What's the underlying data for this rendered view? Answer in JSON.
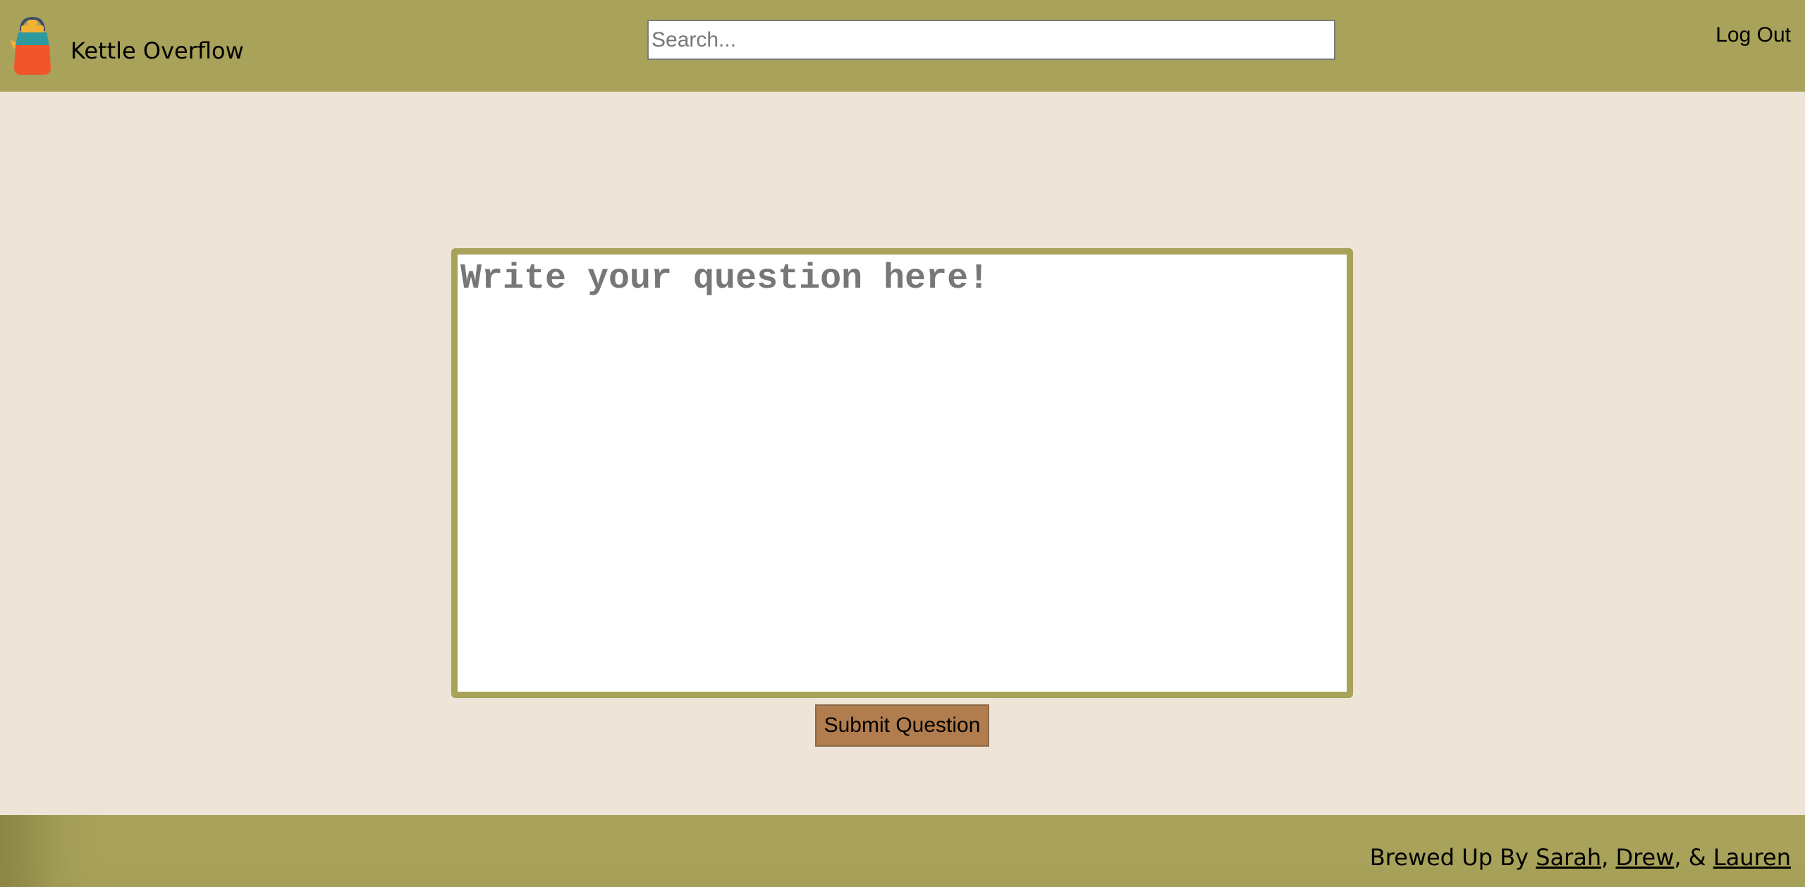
{
  "header": {
    "brand": "Kettle Overflow",
    "logo_icon": "kettle-icon",
    "search": {
      "placeholder": "Search...",
      "value": ""
    },
    "logout_label": "Log Out"
  },
  "main": {
    "question": {
      "placeholder": "Write your question here!",
      "value": ""
    },
    "submit_label": "Submit Question"
  },
  "footer": {
    "prefix": "Brewed Up By ",
    "authors": [
      "Sarah",
      "Drew",
      "Lauren"
    ],
    "sep1": ", ",
    "sep2": ", & "
  },
  "colors": {
    "header_bg": "#a8a25a",
    "page_bg": "#efe4d8",
    "button_bg": "#b27d4e",
    "accent_border": "#a8a25a"
  }
}
